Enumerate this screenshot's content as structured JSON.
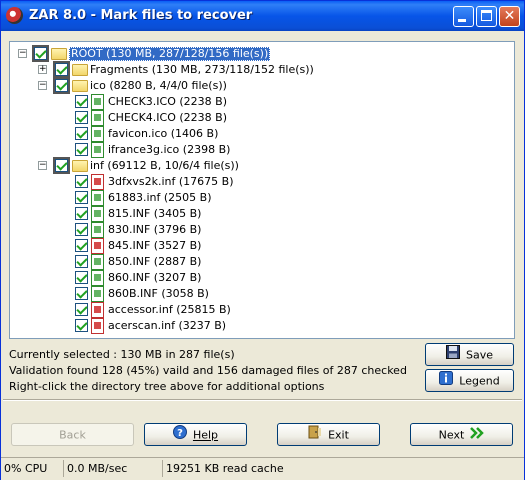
{
  "window": {
    "title": "ZAR 8.0 - Mark files to recover",
    "close_glyph": "✕"
  },
  "tree": {
    "root": {
      "label": "ROOT (130 MB, 287/128/156 file(s))",
      "expander": "−"
    },
    "fragments": {
      "label": "Fragments (130 MB, 273/118/152 file(s))",
      "expander": "+"
    },
    "ico": {
      "label": "ico (8280 B, 4/4/0 file(s))",
      "expander": "−",
      "files": [
        {
          "name": "CHECK3.ICO (2238 B)",
          "status": "valid"
        },
        {
          "name": "CHECK4.ICO (2238 B)",
          "status": "valid"
        },
        {
          "name": "favicon.ico (1406 B)",
          "status": "valid"
        },
        {
          "name": "ifrance3g.ico (2398 B)",
          "status": "valid"
        }
      ]
    },
    "inf": {
      "label": "inf (69112 B, 10/6/4 file(s))",
      "expander": "−",
      "files": [
        {
          "name": "3dfxvs2k.inf (17675 B)",
          "status": "damaged"
        },
        {
          "name": "61883.inf (2505 B)",
          "status": "valid"
        },
        {
          "name": "815.INF (3405 B)",
          "status": "valid"
        },
        {
          "name": "830.INF (3796 B)",
          "status": "valid"
        },
        {
          "name": "845.INF (3527 B)",
          "status": "damaged"
        },
        {
          "name": "850.INF (2887 B)",
          "status": "valid"
        },
        {
          "name": "860.INF (3207 B)",
          "status": "valid"
        },
        {
          "name": "860B.INF (3058 B)",
          "status": "valid"
        },
        {
          "name": "accessor.inf (25815 B)",
          "status": "damaged"
        },
        {
          "name": "acerscan.inf (3237 B)",
          "status": "damaged"
        }
      ]
    }
  },
  "info": {
    "selected": "Currently selected : 130 MB in 287 file(s)",
    "validation": "Validation found 128 (45%)  vaild and 156 damaged files of 287 checked",
    "hint": "Right-click the directory tree above for additional options"
  },
  "buttons": {
    "save": "Save",
    "legend": "Legend",
    "back": "Back",
    "help": "Help",
    "exit": "Exit",
    "next": "Next"
  },
  "colors": {
    "valid": "#2e8b2e",
    "damaged": "#c03030",
    "selection": "#316ac5"
  },
  "statusbar": {
    "cpu": "0% CPU",
    "speed": "0.0 MB/sec",
    "cache": "19251 KB read cache"
  }
}
